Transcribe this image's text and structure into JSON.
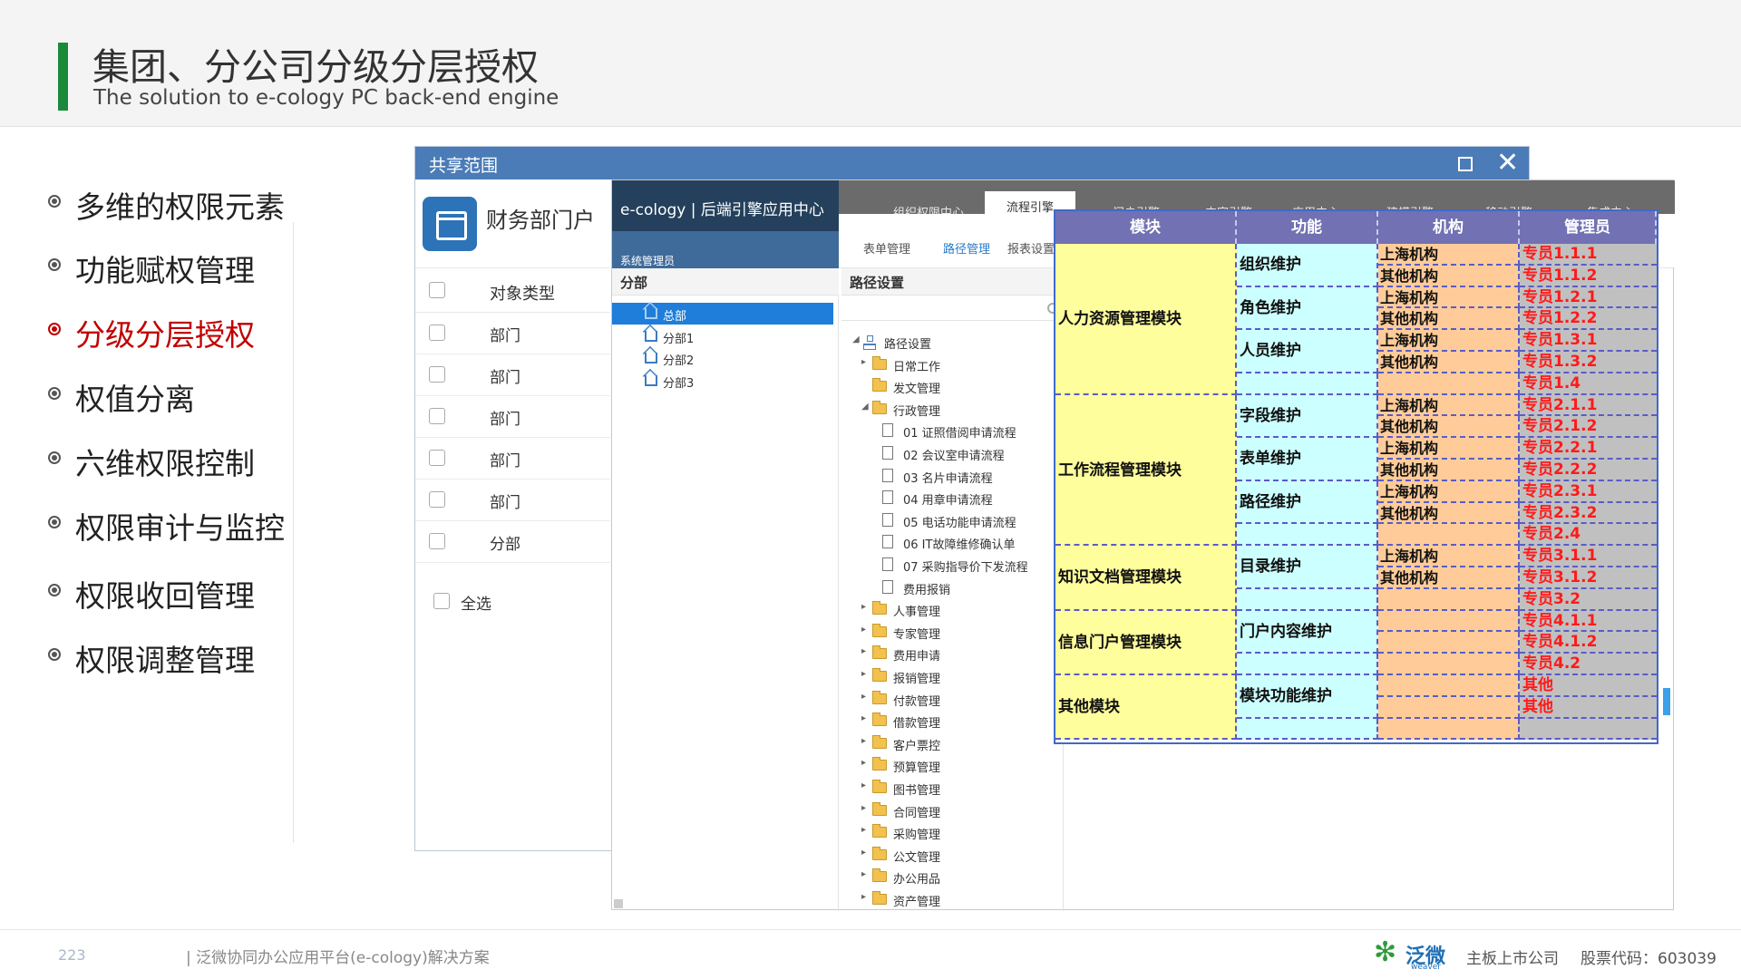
{
  "header": {
    "title": "集团、分公司分级分层授权",
    "subtitle": "The solution to e-cology PC back-end engine"
  },
  "menu": {
    "items": [
      {
        "label": "多维的权限元素",
        "active": false
      },
      {
        "label": "功能赋权管理",
        "active": false
      },
      {
        "label": "分级分层授权",
        "active": true
      },
      {
        "label": "权值分离",
        "active": false
      },
      {
        "label": "六维权限控制",
        "active": false
      },
      {
        "label": "权限审计与监控",
        "active": false
      },
      {
        "label": "权限收回管理",
        "active": false
      },
      {
        "label": "权限调整管理",
        "active": false
      }
    ]
  },
  "share_window": {
    "title": "共享范围",
    "portal_name": "财务部门户",
    "column_header": "对象类型",
    "rows": [
      "部门",
      "部门",
      "部门",
      "部门",
      "部门",
      "分部"
    ],
    "select_all": "全选"
  },
  "ecology_window": {
    "brand": "e-cology | 后端引擎应用中心",
    "admin_label": "系统管理员",
    "top_nav": [
      "组织权限中心",
      "流程引擎",
      "门户引擎",
      "内容引擎",
      "应用中心",
      "建模引擎",
      "移动引擎",
      "集成中心"
    ],
    "top_nav_active": "流程引擎",
    "sub_nav": [
      "表单管理",
      "路径管理",
      "报表设置"
    ],
    "sub_nav_active": "路径管理",
    "col1_header": "分部",
    "col1_tree": [
      {
        "label": "总部",
        "selected": true
      },
      {
        "label": "分部1",
        "selected": false
      },
      {
        "label": "分部2",
        "selected": false
      },
      {
        "label": "分部3",
        "selected": false
      }
    ],
    "col2_header": "路径设置",
    "col2_tree": [
      {
        "label": "路径设置",
        "icon": "org",
        "arrow": "◢",
        "depth": 0
      },
      {
        "label": "日常工作",
        "icon": "folder",
        "arrow": "▸",
        "depth": 1
      },
      {
        "label": "发文管理",
        "icon": "folder",
        "arrow": "",
        "depth": 1
      },
      {
        "label": "行政管理",
        "icon": "folder",
        "arrow": "◢",
        "depth": 1
      },
      {
        "label": "01 证照借阅申请流程",
        "icon": "file",
        "arrow": "",
        "depth": 2
      },
      {
        "label": "02 会议室申请流程",
        "icon": "file",
        "arrow": "",
        "depth": 2
      },
      {
        "label": "03 名片申请流程",
        "icon": "file",
        "arrow": "",
        "depth": 2
      },
      {
        "label": "04 用章申请流程",
        "icon": "file",
        "arrow": "",
        "depth": 2
      },
      {
        "label": "05 电话功能申请流程",
        "icon": "file",
        "arrow": "",
        "depth": 2
      },
      {
        "label": "06 IT故障维修确认单",
        "icon": "file",
        "arrow": "",
        "depth": 2
      },
      {
        "label": "07 采购指导价下发流程",
        "icon": "file",
        "arrow": "",
        "depth": 2
      },
      {
        "label": "费用报销",
        "icon": "file",
        "arrow": "",
        "depth": 2
      },
      {
        "label": "人事管理",
        "icon": "folder",
        "arrow": "▸",
        "depth": 1
      },
      {
        "label": "专家管理",
        "icon": "folder",
        "arrow": "▸",
        "depth": 1
      },
      {
        "label": "费用申请",
        "icon": "folder",
        "arrow": "▸",
        "depth": 1
      },
      {
        "label": "报销管理",
        "icon": "folder",
        "arrow": "▸",
        "depth": 1
      },
      {
        "label": "付款管理",
        "icon": "folder",
        "arrow": "▸",
        "depth": 1
      },
      {
        "label": "借款管理",
        "icon": "folder",
        "arrow": "▸",
        "depth": 1
      },
      {
        "label": "客户票控",
        "icon": "folder",
        "arrow": "▸",
        "depth": 1
      },
      {
        "label": "预算管理",
        "icon": "folder",
        "arrow": "▸",
        "depth": 1
      },
      {
        "label": "图书管理",
        "icon": "folder",
        "arrow": "▸",
        "depth": 1
      },
      {
        "label": "合同管理",
        "icon": "folder",
        "arrow": "▸",
        "depth": 1
      },
      {
        "label": "采购管理",
        "icon": "folder",
        "arrow": "▸",
        "depth": 1
      },
      {
        "label": "公文管理",
        "icon": "folder",
        "arrow": "▸",
        "depth": 1
      },
      {
        "label": "办公用品",
        "icon": "folder",
        "arrow": "▸",
        "depth": 1
      },
      {
        "label": "资产管理",
        "icon": "folder",
        "arrow": "▸",
        "depth": 1
      }
    ]
  },
  "perm_table": {
    "headers": [
      "模块",
      "功能",
      "机构",
      "管理员"
    ],
    "modules": [
      {
        "name": "人力资源管理模块",
        "rows": 7
      },
      {
        "name": "工作流程管理模块",
        "rows": 7
      },
      {
        "name": "知识文档管理模块",
        "rows": 3
      },
      {
        "name": "信息门户管理模块",
        "rows": 3
      },
      {
        "name": "其他模块",
        "rows": 3
      }
    ],
    "functions": [
      {
        "name": "组织维护",
        "rows": 2
      },
      {
        "name": "角色维护",
        "rows": 2
      },
      {
        "name": "人员维护",
        "rows": 2
      },
      {
        "name": "",
        "rows": 1
      },
      {
        "name": "字段维护",
        "rows": 2
      },
      {
        "name": "表单维护",
        "rows": 2
      },
      {
        "name": "路径维护",
        "rows": 2
      },
      {
        "name": "",
        "rows": 1
      },
      {
        "name": "目录维护",
        "rows": 2
      },
      {
        "name": "",
        "rows": 1
      },
      {
        "name": "门户内容维护",
        "rows": 2
      },
      {
        "name": "",
        "rows": 1
      },
      {
        "name": "模块功能维护",
        "rows": 2
      },
      {
        "name": "",
        "rows": 1
      }
    ],
    "orgs": [
      "上海机构",
      "其他机构",
      "上海机构",
      "其他机构",
      "上海机构",
      "其他机构",
      "",
      "上海机构",
      "其他机构",
      "上海机构",
      "其他机构",
      "上海机构",
      "其他机构",
      "",
      "上海机构",
      "其他机构",
      "",
      "",
      "",
      "",
      "",
      "",
      ""
    ],
    "admins": [
      "专员1.1.1",
      "专员1.1.2",
      "专员1.2.1",
      "专员1.2.2",
      "专员1.3.1",
      "专员1.3.2",
      "专员1.4",
      "专员2.1.1",
      "专员2.1.2",
      "专员2.2.1",
      "专员2.2.2",
      "专员2.3.1",
      "专员2.3.2",
      "专员2.4",
      "专员3.1.1",
      "专员3.1.2",
      "专员3.2",
      "专员4.1.1",
      "专员4.1.2",
      "专员4.2",
      "其他",
      "其他",
      ""
    ]
  },
  "footer": {
    "page_number": "223",
    "doc_title": "| 泛微协同办公应用平台(e-cology)解决方案",
    "logo_text": "泛微",
    "logo_sub": "weaver",
    "listed": "主板上市公司",
    "stock_code": "股票代码：603039"
  },
  "colors": {
    "accent_green": "#1a8a3a",
    "active_red": "#c00000",
    "window_blue": "#4b7cb7",
    "table_header": "#7171b3",
    "module_yellow": "#fffe9c",
    "function_cyan": "#ccffff",
    "org_orange": "#ffcc99",
    "admin_gray": "#c0c0c0"
  }
}
